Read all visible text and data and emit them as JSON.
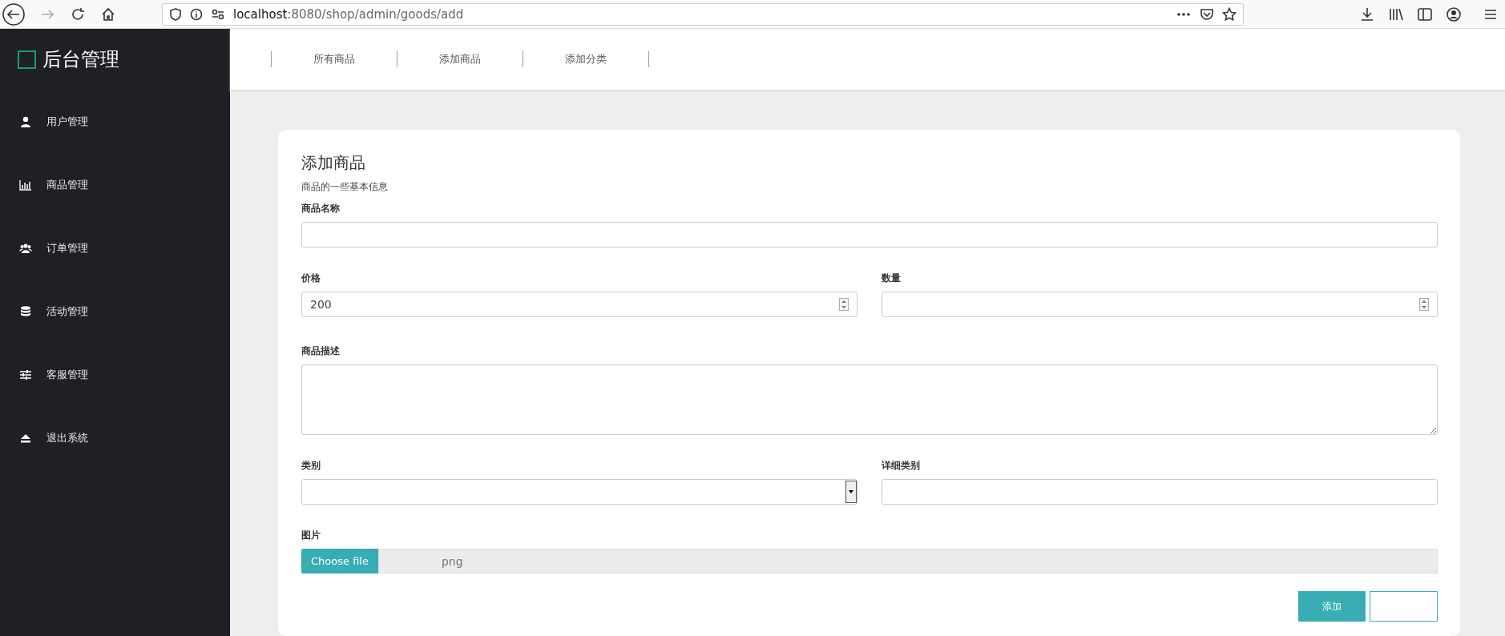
{
  "browser": {
    "url_host": "localhost",
    "url_path": ":8080/shop/admin/goods/add"
  },
  "sidebar": {
    "title": "后台管理",
    "items": [
      {
        "label": "用户管理"
      },
      {
        "label": "商品管理"
      },
      {
        "label": "订单管理"
      },
      {
        "label": "活动管理"
      },
      {
        "label": "客服管理"
      },
      {
        "label": "退出系统"
      }
    ]
  },
  "top_nav": [
    "所有商品",
    "添加商品",
    "添加分类"
  ],
  "form": {
    "title": "添加商品",
    "subtitle": "商品的一些基本信息",
    "rows": [
      [
        {
          "label": "商品名称",
          "kind": "text"
        }
      ],
      [
        {
          "label": "价格",
          "kind": "number",
          "value": "200"
        },
        {
          "label": "数量",
          "kind": "number"
        }
      ],
      [
        {
          "label": "商品描述",
          "kind": "textarea"
        }
      ],
      [
        {
          "label": "类别",
          "kind": "select"
        },
        {
          "label": "详细类别",
          "kind": "text"
        }
      ],
      [
        {
          "label": "图片",
          "kind": "file",
          "button": "Choose file",
          "value": "png"
        }
      ]
    ],
    "submit": "添加"
  }
}
